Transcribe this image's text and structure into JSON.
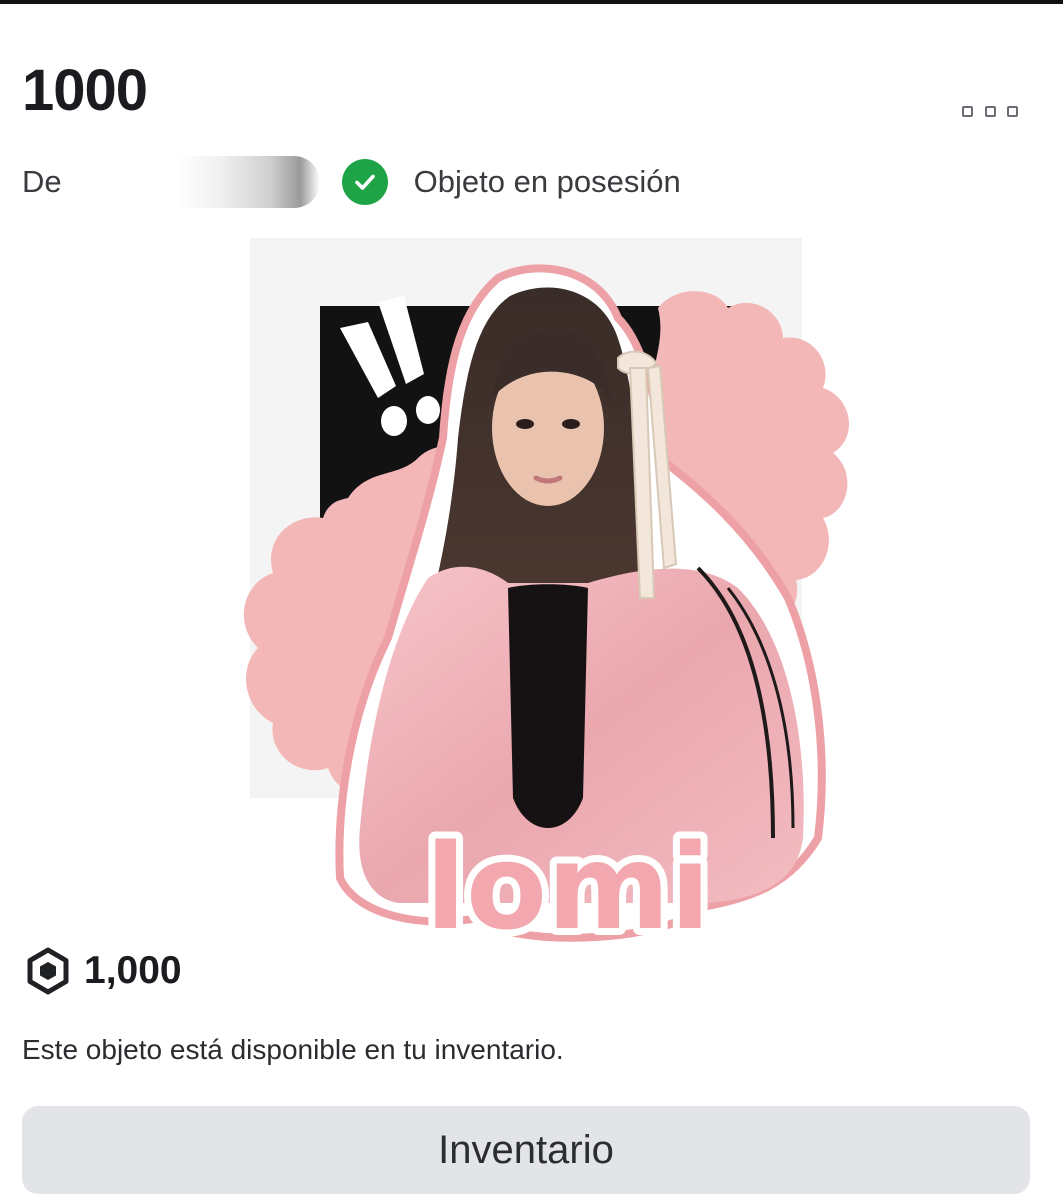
{
  "item": {
    "title": "1000",
    "creator_prefix": "De",
    "creator_name": "",
    "owned_label": "Objeto en posesión",
    "price": "1,000",
    "availability_text": "Este objeto está disponible en tu inventario.",
    "inventory_button_label": "Inventario"
  },
  "thumbnail": {
    "sticker_text": "lomi",
    "description": "shirt thumbnail: sticker-style image of a girl in a pink satin jacket over pink wavy badge with exclamation marks"
  },
  "icons": {
    "more": "more-options-icon",
    "owned": "checkmark-icon",
    "currency": "robux-icon"
  },
  "colors": {
    "owned_green": "#1ea446",
    "badge_pink": "#f4b7b8",
    "button_bg": "#e3e4e7"
  }
}
